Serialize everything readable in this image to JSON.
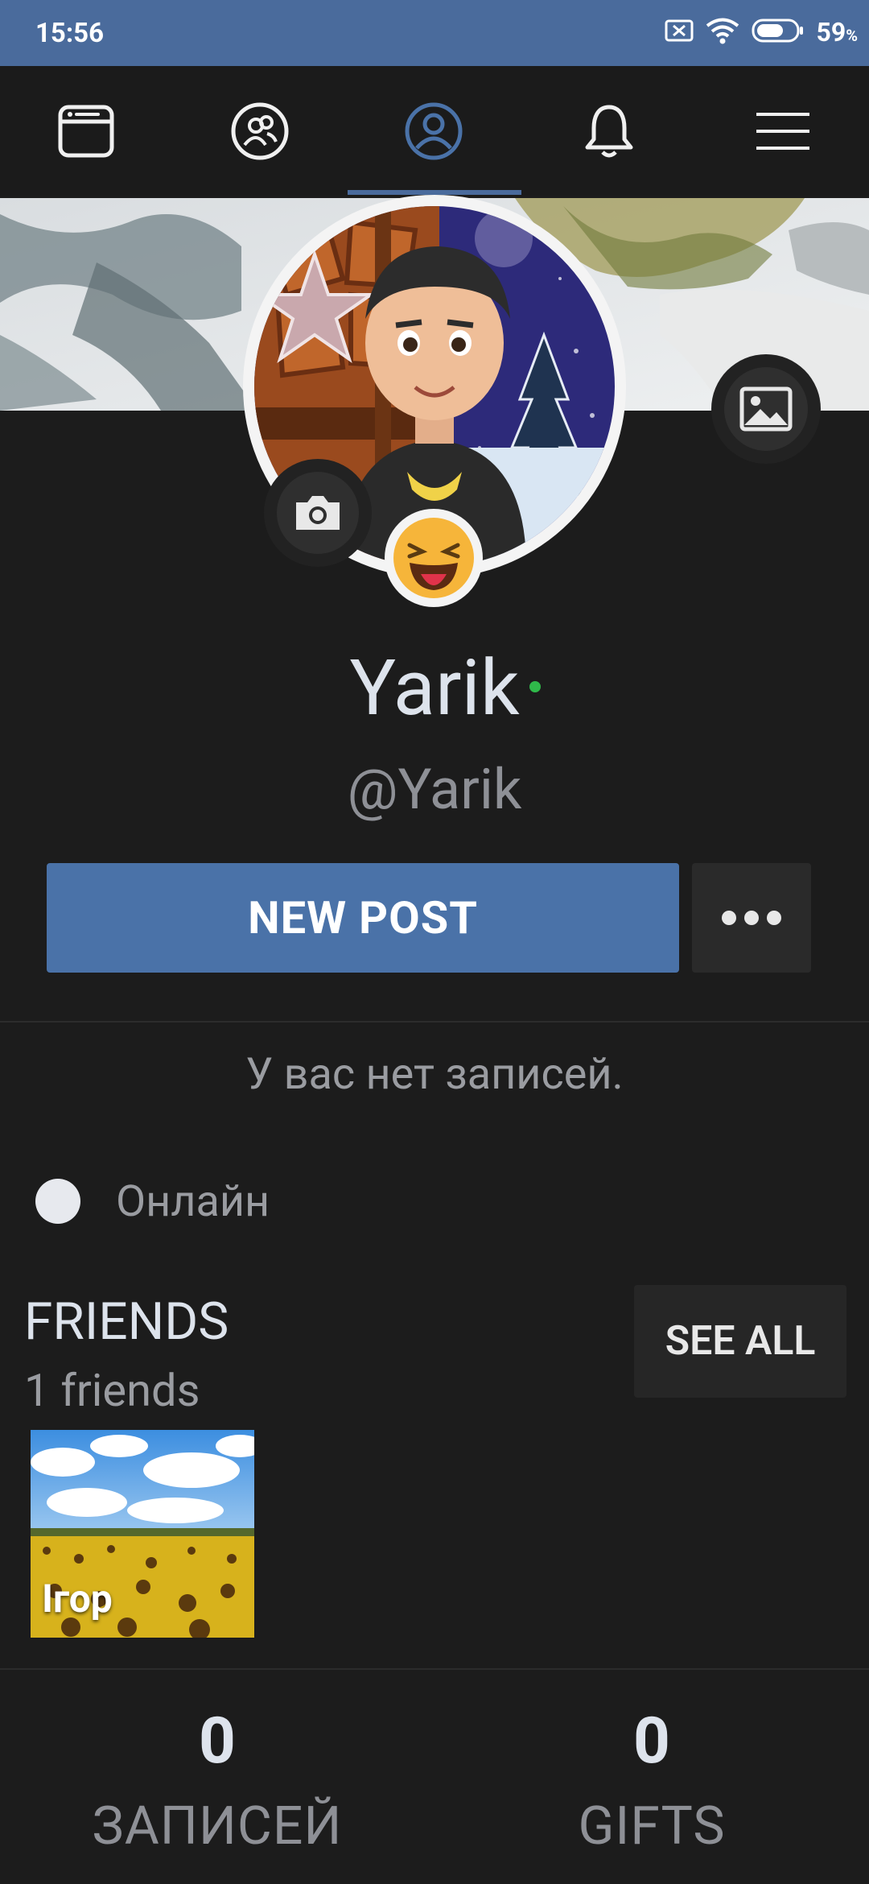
{
  "status_bar": {
    "time": "15:56",
    "battery_percent": "59",
    "battery_unit": "%"
  },
  "nav": {
    "items": [
      {
        "icon": "news-feed-icon",
        "active": false
      },
      {
        "icon": "friends-icon",
        "active": false
      },
      {
        "icon": "profile-icon",
        "active": true
      },
      {
        "icon": "bell-icon",
        "active": false
      },
      {
        "icon": "menu-icon",
        "active": false
      }
    ]
  },
  "profile": {
    "name": "Yarik",
    "handle": "@Yarik",
    "online": true,
    "status_emoji": "😝"
  },
  "actions": {
    "new_post_label": "NEW POST"
  },
  "wall": {
    "empty_text": "У вас нет записей."
  },
  "status": {
    "label": "Онлайн"
  },
  "friends": {
    "title": "FRIENDS",
    "count_text": "1 friends",
    "see_all_label": "SEE ALL",
    "items": [
      {
        "name": "Ігор"
      }
    ]
  },
  "stats": [
    {
      "value": "0",
      "label": "ЗАПИСЕЙ"
    },
    {
      "value": "0",
      "label": "GIFTS"
    }
  ],
  "colors": {
    "accent": "#4a72a8",
    "status_bar": "#4a6b9c",
    "background": "#1c1c1c",
    "online": "#2fb94a"
  }
}
